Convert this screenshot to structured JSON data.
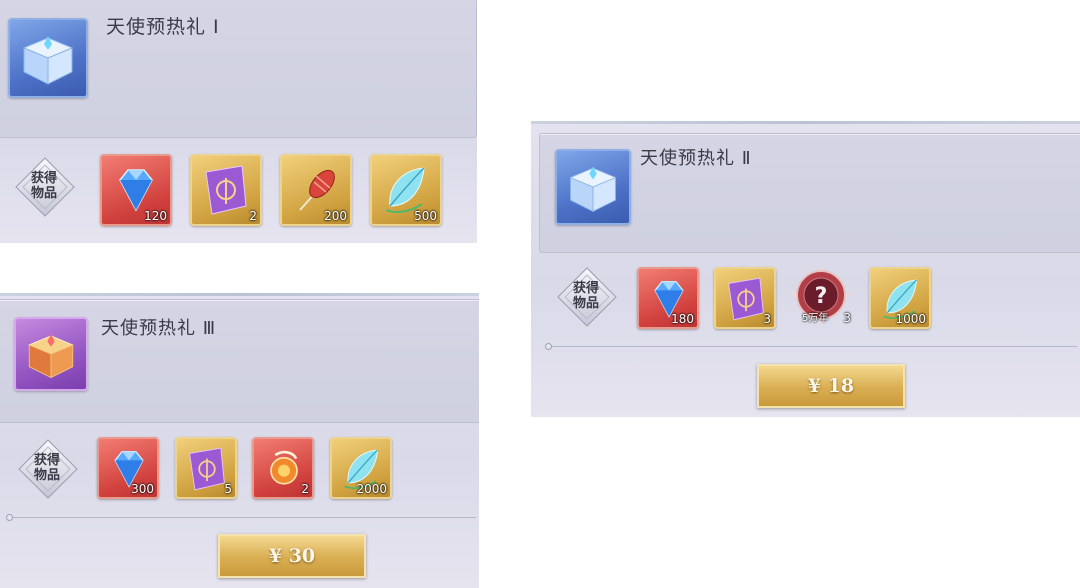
{
  "label_obtain": "获得物品",
  "labels": {
    "obtain_line1": "获得",
    "obtain_line2": "物品"
  },
  "packs": [
    {
      "title": "天使预热礼 Ⅰ",
      "items": [
        {
          "icon": "blue-diamond-icon",
          "qty": "120",
          "frame": "red"
        },
        {
          "icon": "purple-card-icon",
          "qty": "2",
          "frame": "gold"
        },
        {
          "icon": "roast-sausage-icon",
          "qty": "200",
          "frame": "gold"
        },
        {
          "icon": "crystal-feather-icon",
          "qty": "500",
          "frame": "gold"
        }
      ]
    },
    {
      "title": "天使预热礼 Ⅱ",
      "items": [
        {
          "icon": "blue-diamond-icon",
          "qty": "180",
          "frame": "red"
        },
        {
          "icon": "purple-card-icon",
          "qty": "3",
          "frame": "gold"
        },
        {
          "icon": "mystery-soul-ring-icon",
          "qty": "3",
          "sub": "5万年",
          "frame": "badge"
        },
        {
          "icon": "crystal-feather-icon",
          "qty": "1000",
          "frame": "gold"
        }
      ],
      "price": "¥ 18"
    },
    {
      "title": "天使预热礼 Ⅲ",
      "items": [
        {
          "icon": "blue-diamond-icon",
          "qty": "300",
          "frame": "red"
        },
        {
          "icon": "purple-card-icon",
          "qty": "5",
          "frame": "gold"
        },
        {
          "icon": "fire-orb-icon",
          "qty": "2",
          "frame": "red"
        },
        {
          "icon": "crystal-feather-icon",
          "qty": "2000",
          "frame": "gold"
        }
      ],
      "price": "¥ 30"
    }
  ],
  "colors": {
    "price_gold": "#d9ae52",
    "item_red": "#d1413e",
    "item_gold": "#d0a240",
    "panel_bg": "#d9d9e8"
  }
}
